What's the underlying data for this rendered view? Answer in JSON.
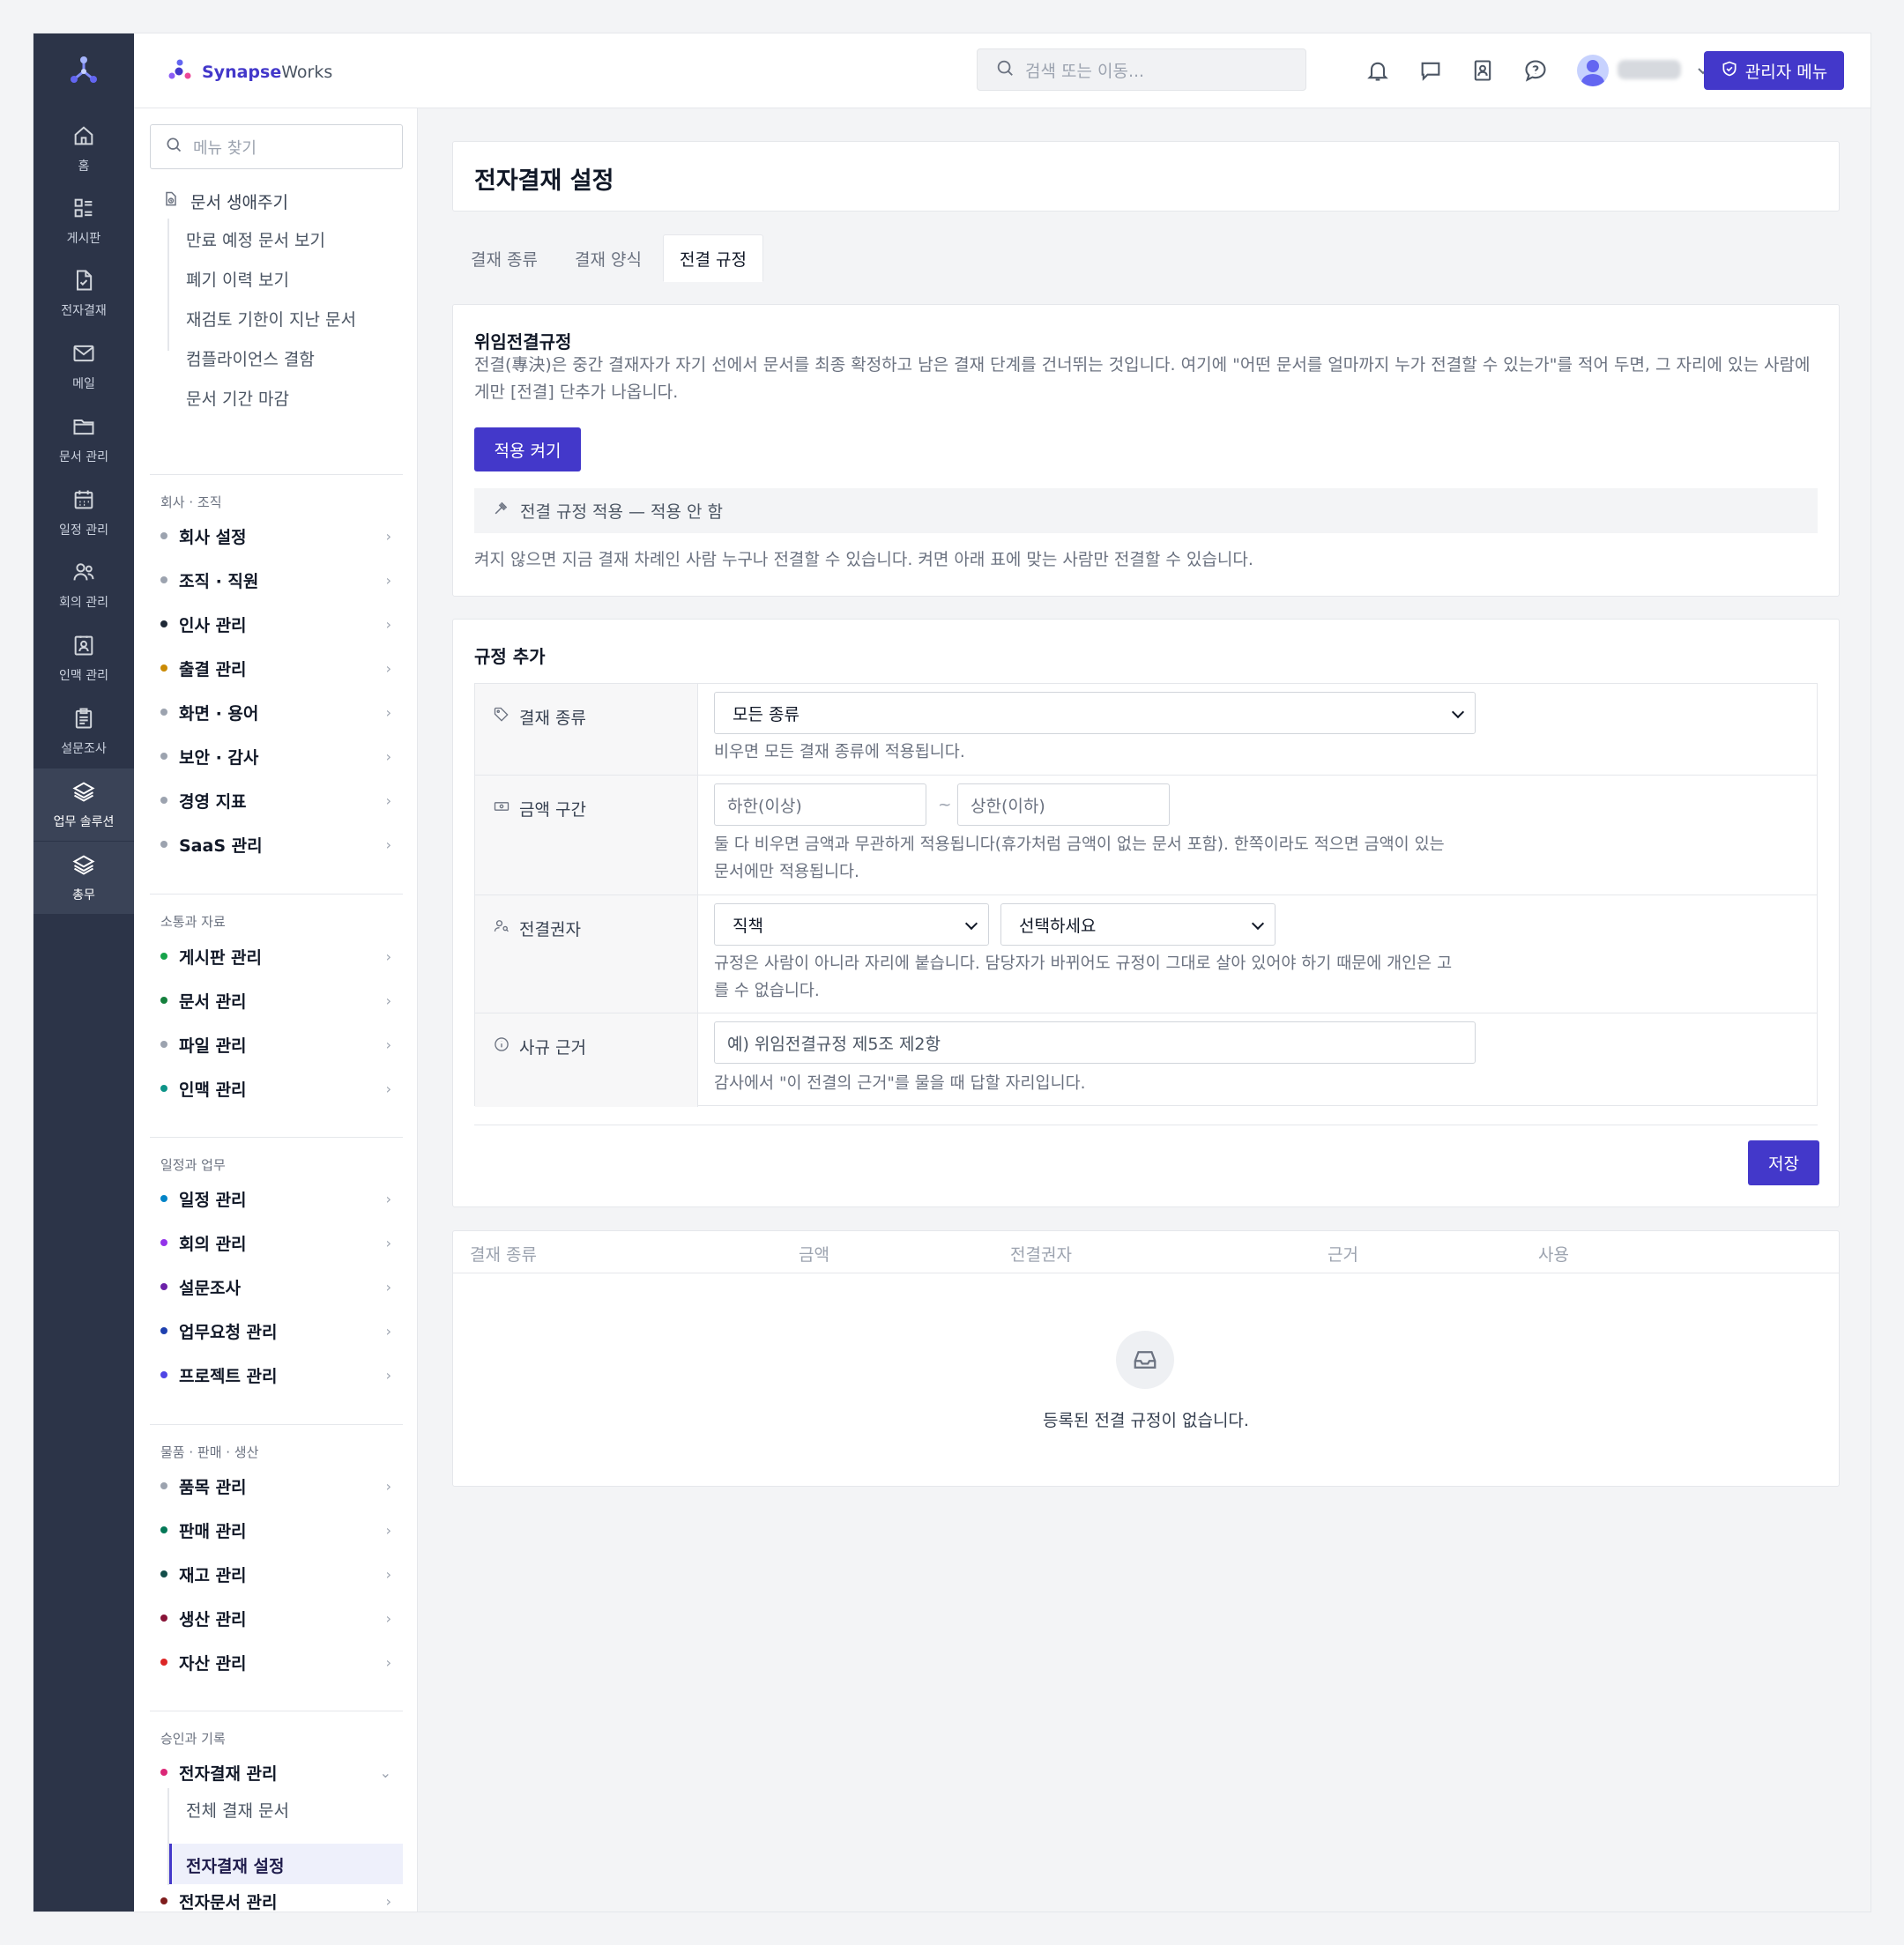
{
  "rail": {
    "items": [
      {
        "label": "홈",
        "icon": "home-icon"
      },
      {
        "label": "게시판",
        "icon": "board-icon"
      },
      {
        "label": "전자결재",
        "icon": "approval-doc-icon"
      },
      {
        "label": "메일",
        "icon": "mail-icon"
      },
      {
        "label": "문서 관리",
        "icon": "folder-icon"
      },
      {
        "label": "일정 관리",
        "icon": "calendar-icon"
      },
      {
        "label": "회의 관리",
        "icon": "users-icon"
      },
      {
        "label": "인맥 관리",
        "icon": "contact-icon"
      },
      {
        "label": "설문조사",
        "icon": "clipboard-icon"
      },
      {
        "label": "업무 솔루션",
        "icon": "layers-icon"
      },
      {
        "label": "총무",
        "icon": "layers-icon"
      }
    ]
  },
  "topbar": {
    "brand_bold": "Synapse",
    "brand_light": "Works",
    "search_placeholder": "검색 또는 이동...",
    "admin_label": "관리자 메뉴"
  },
  "side": {
    "search_placeholder": "메뉴 찾기",
    "lifecycle_label": "문서 생애주기",
    "lifecycle_items": [
      "만료 예정 문서 보기",
      "폐기 이력 보기",
      "재검토 기한이 지난 문서",
      "컴플라이언스 결함",
      "문서 기간 마감"
    ],
    "groups": [
      {
        "title": "회사 · 조직",
        "items": [
          {
            "label": "회사 설정",
            "color": "#9ca3af"
          },
          {
            "label": "조직 · 직원",
            "color": "#9ca3af"
          },
          {
            "label": "인사 관리",
            "color": "#1f2937"
          },
          {
            "label": "출결 관리",
            "color": "#ca8a04"
          },
          {
            "label": "화면 · 용어",
            "color": "#9ca3af"
          },
          {
            "label": "보안 · 감사",
            "color": "#9ca3af"
          },
          {
            "label": "경영 지표",
            "color": "#9ca3af"
          },
          {
            "label": "SaaS 관리",
            "color": "#9ca3af"
          }
        ]
      },
      {
        "title": "소통과 자료",
        "items": [
          {
            "label": "게시판 관리",
            "color": "#16a34a"
          },
          {
            "label": "문서 관리",
            "color": "#15803d"
          },
          {
            "label": "파일 관리",
            "color": "#9ca3af"
          },
          {
            "label": "인맥 관리",
            "color": "#0d9488"
          }
        ]
      },
      {
        "title": "일정과 업무",
        "items": [
          {
            "label": "일정 관리",
            "color": "#0284c7"
          },
          {
            "label": "회의 관리",
            "color": "#9333ea"
          },
          {
            "label": "설문조사",
            "color": "#6b21a8"
          },
          {
            "label": "업무요청 관리",
            "color": "#1e40af"
          },
          {
            "label": "프로젝트 관리",
            "color": "#4f46e5"
          }
        ]
      },
      {
        "title": "물품 · 판매 · 생산",
        "items": [
          {
            "label": "품목 관리",
            "color": "#9ca3af"
          },
          {
            "label": "판매 관리",
            "color": "#047857"
          },
          {
            "label": "재고 관리",
            "color": "#134e4a"
          },
          {
            "label": "생산 관리",
            "color": "#881337"
          },
          {
            "label": "자산 관리",
            "color": "#dc2626"
          }
        ]
      },
      {
        "title": "승인과 기록",
        "items": [
          {
            "label": "전자결재 관리",
            "color": "#db2777"
          },
          {
            "label": "전자문서 관리",
            "color": "#7f1d1d"
          }
        ]
      }
    ],
    "approval_sub": [
      "전체 결재 문서",
      "전자결재 설정"
    ]
  },
  "page": {
    "title": "전자결재 설정",
    "tabs": [
      "결재 종류",
      "결재 양식",
      "전결 규정"
    ]
  },
  "delegation": {
    "title": "위임전결규정",
    "desc_line1": "전결(專決)은 중간 결재자가 자기 선에서 문서를 최종 확정하고 남은 결재 단계를 건너뛰는 것입니다. 여기에 \"어떤 문서를 얼마까지 누가 전결할 수 있는가\"를 적어 두면, 그 자리에 있는 사람에",
    "desc_line2": "게만 [전결] 단추가 나옵니다.",
    "enable_button": "적용 켜기",
    "status_text": "전결 규정 적용 — 적용 안 함",
    "note": "켜지 않으면 지금 결재 차례인 사람 누구나 전결할 수 있습니다. 켜면 아래 표에 맞는 사람만 전결할 수 있습니다."
  },
  "add_rule": {
    "title": "규정 추가",
    "fields": {
      "type": {
        "label": "결재 종류",
        "value": "모든 종류",
        "hint": "비우면 모든 결재 종류에 적용됩니다."
      },
      "amount": {
        "label": "금액 구간",
        "min_placeholder": "하한(이상)",
        "max_placeholder": "상한(이하)",
        "separator": "~",
        "hint_line1": "둘 다 비우면 금액과 무관하게 적용됩니다(휴가처럼 금액이 없는 문서 포함). 한쪽이라도 적으면 금액이 있는",
        "hint_line2": "문서에만 적용됩니다."
      },
      "authority": {
        "label": "전결권자",
        "value1": "직책",
        "value2": "선택하세요",
        "hint_line1": "규정은 사람이 아니라 자리에 붙습니다. 담당자가 바뀌어도 규정이 그대로 살아 있어야 하기 때문에 개인은 고",
        "hint_line2": "를 수 없습니다."
      },
      "basis": {
        "label": "사규 근거",
        "placeholder": "예) 위임전결규정 제5조 제2항",
        "hint": "감사에서 \"이 전결의 근거\"를 물을 때 답할 자리입니다."
      }
    },
    "save_button": "저장"
  },
  "rules_table": {
    "headers": [
      "결재 종류",
      "금액",
      "전결권자",
      "근거",
      "사용"
    ],
    "empty_text": "등록된 전결 규정이 없습니다."
  },
  "colors": {
    "accent": "#4338ca",
    "rail": "#2c3448"
  }
}
